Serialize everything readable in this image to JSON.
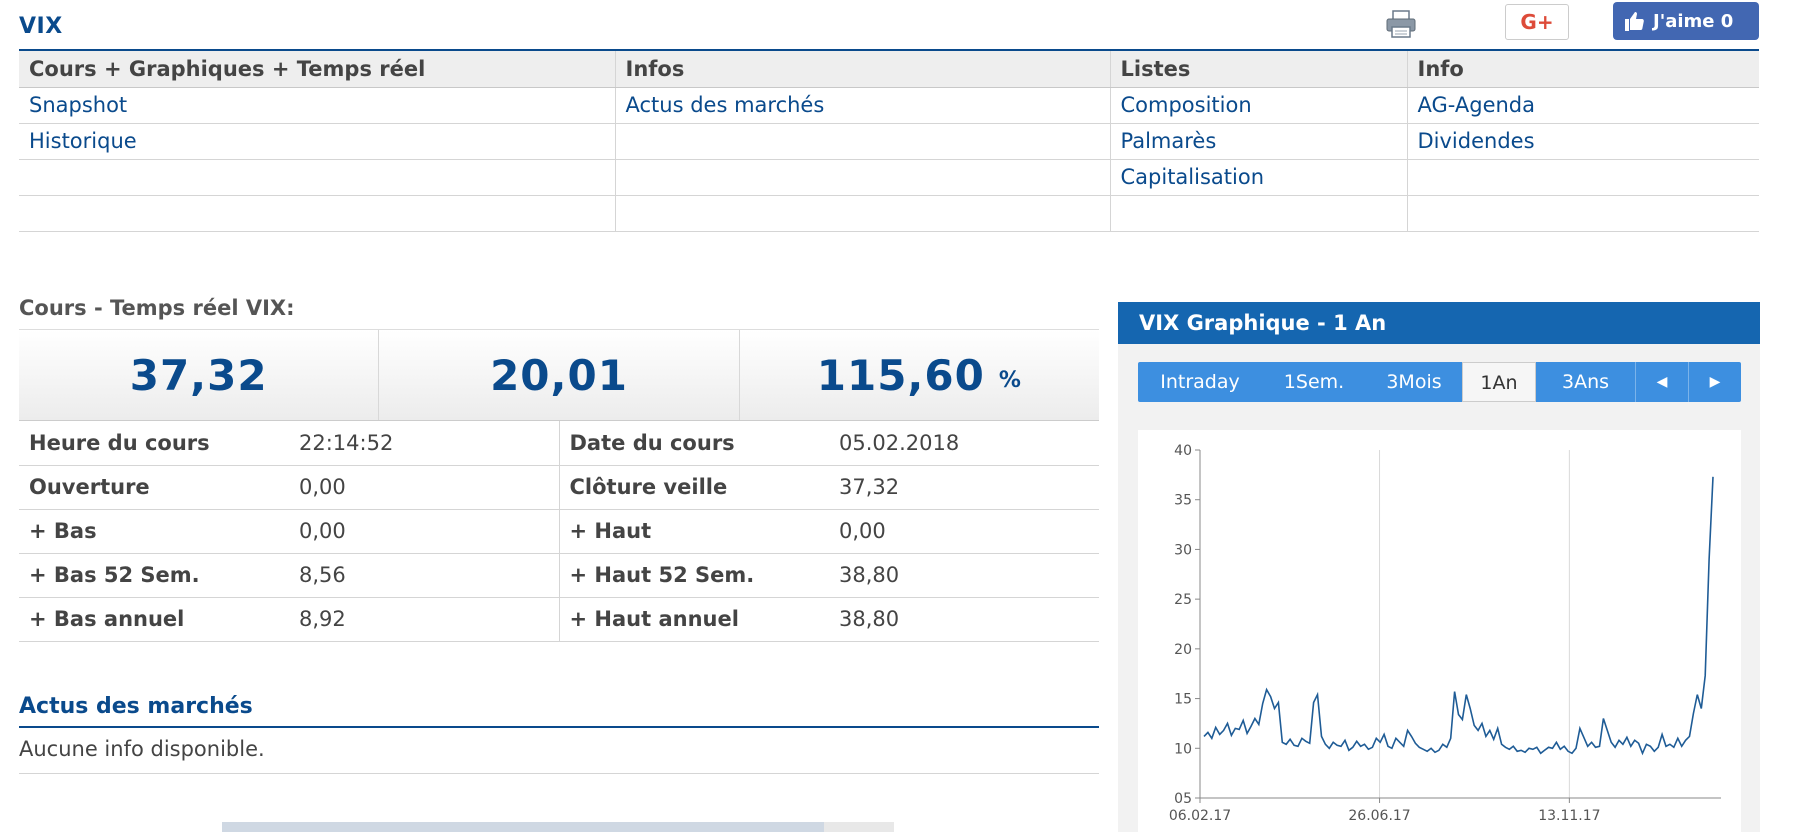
{
  "page": {
    "title": "VIX",
    "gplus_label": "G+",
    "fb_like_label": "J'aime 0"
  },
  "nav": {
    "headers": [
      "Cours + Graphiques + Temps réel",
      "Infos",
      "Listes",
      "Info"
    ],
    "rows": [
      [
        "Snapshot",
        "Actus des marchés",
        "Composition",
        "AG-Agenda"
      ],
      [
        "Historique",
        "",
        "Palmarès",
        "Dividendes"
      ],
      [
        "",
        "",
        "Capitalisation",
        ""
      ],
      [
        "",
        "",
        "",
        ""
      ]
    ]
  },
  "quote": {
    "section_title": "Cours - Temps réel VIX:",
    "price": "37,32",
    "change": "20,01",
    "change_pct": "115,60",
    "pct_unit": "%"
  },
  "details": [
    {
      "label1": "Heure du cours",
      "value1": "22:14:52",
      "label2": "Date du cours",
      "value2": "05.02.2018"
    },
    {
      "label1": "Ouverture",
      "value1": "0,00",
      "label2": "Clôture veille",
      "value2": "37,32"
    },
    {
      "label1": "+ Bas",
      "value1": "0,00",
      "label2": "+ Haut",
      "value2": "0,00"
    },
    {
      "label1": "+ Bas 52 Sem.",
      "value1": "8,56",
      "label2": "+ Haut 52 Sem.",
      "value2": "38,80"
    },
    {
      "label1": "+ Bas annuel",
      "value1": "8,92",
      "label2": "+ Haut annuel",
      "value2": "38,80"
    }
  ],
  "news": {
    "title": "Actus des marchés",
    "empty_text": "Aucune info disponible."
  },
  "chart_panel": {
    "header": "VIX Graphique - 1 An",
    "tabs": [
      "Intraday",
      "1Sem.",
      "3Mois",
      "1An",
      "3Ans"
    ],
    "active_tab": "1An",
    "prev_label": "◀",
    "next_label": "▶"
  },
  "colors": {
    "brand": "#0a4a8c",
    "header_blue": "#1566b0",
    "tab_blue": "#3d8fe0",
    "line": "#1f5c96"
  },
  "chart_data": {
    "type": "line",
    "title": "",
    "xlabel": "",
    "ylabel": "",
    "ylim": [
      5,
      40
    ],
    "yticks": [
      "05",
      "10",
      "15",
      "20",
      "25",
      "30",
      "35",
      "40"
    ],
    "xticks": [
      "06.02.17",
      "26.06.17",
      "13.11.17"
    ],
    "grid": true,
    "series": [
      {
        "values": [
          11.2,
          11.6,
          11.0,
          12.1,
          11.4,
          11.8,
          12.5,
          11.3,
          12.0,
          11.9,
          12.8,
          11.5,
          12.2,
          13.0,
          12.4,
          14.5,
          15.9,
          15.2,
          14.0,
          14.6,
          10.6,
          10.4,
          10.9,
          10.3,
          10.2,
          11.0,
          10.7,
          10.5,
          14.6,
          15.4,
          11.2,
          10.4,
          10.0,
          10.6,
          10.3,
          10.2,
          10.8,
          9.8,
          10.1,
          10.7,
          10.2,
          10.4,
          9.9,
          10.1,
          11.0,
          10.6,
          11.4,
          10.2,
          10.0,
          11.0,
          10.6,
          10.2,
          11.8,
          11.2,
          10.5,
          10.1,
          9.9,
          9.7,
          10.0,
          9.6,
          9.8,
          10.4,
          10.1,
          11.0,
          15.7,
          13.4,
          12.9,
          15.4,
          14.0,
          12.3,
          11.8,
          12.5,
          11.2,
          11.8,
          10.9,
          12.0,
          10.4,
          10.1,
          9.9,
          10.2,
          9.7,
          9.8,
          9.6,
          10.0,
          9.9,
          10.1,
          9.5,
          9.8,
          10.1,
          10.0,
          10.6,
          9.9,
          10.2,
          9.7,
          9.5,
          10.0,
          12.0,
          11.1,
          10.2,
          10.6,
          10.1,
          10.2,
          13.0,
          11.8,
          10.6,
          10.1,
          10.8,
          10.4,
          11.1,
          10.2,
          10.8,
          10.5,
          9.5,
          10.4,
          10.2,
          9.7,
          10.1,
          11.4,
          10.2,
          10.4,
          10.1,
          11.0,
          10.2,
          10.8,
          11.2,
          13.5,
          15.4,
          14.0,
          17.3,
          29.0,
          37.3
        ]
      }
    ]
  }
}
